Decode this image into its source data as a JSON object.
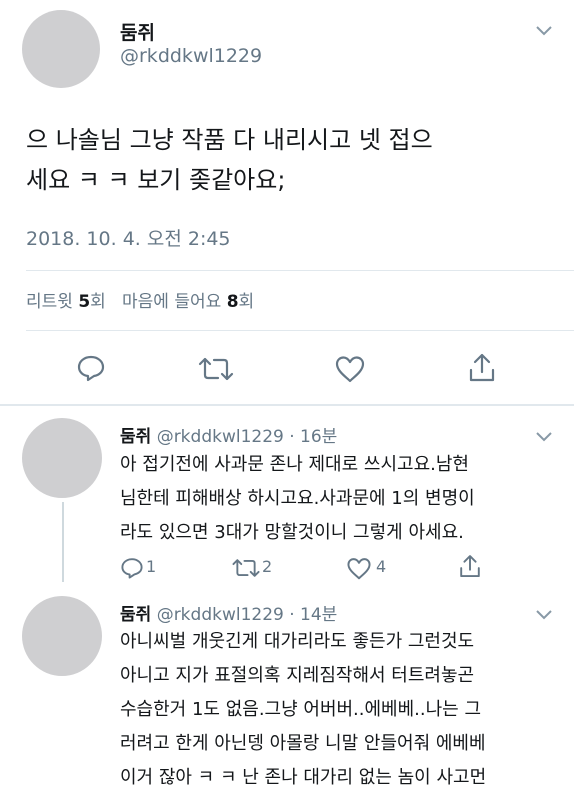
{
  "main_tweet": {
    "display_name": "둠쥐",
    "handle": "@rkddkwl1229",
    "text_line1": "으 나솔님 그냥 작품 다 내리시고 넷 접으",
    "text_line2": "세요 ㅋ ㅋ 보기 좆같아요;",
    "timestamp": "2018. 10. 4. 오전 2:45",
    "retweets_label": "리트윗",
    "retweets_count": "5",
    "retweets_unit": "회",
    "likes_label": "마음에 들어요",
    "likes_count": "8",
    "likes_unit": "회"
  },
  "replies": [
    {
      "display_name": "둠쥐",
      "handle_time": "@rkddkwl1229 · 16분",
      "lines": [
        "아 접기전에 사과문 존나 제대로 쓰시고요.남현",
        "님한테 피해배상 하시고요.사과문에 1의 변명이",
        "라도 있으면 3대가 망할것이니 그렇게 아세요."
      ],
      "reply_count": "1",
      "retweet_count": "2",
      "like_count": "4"
    },
    {
      "display_name": "둠쥐",
      "handle_time": "@rkddkwl1229 · 14분",
      "lines": [
        "아니씨벌 개웃긴게 대가리라도 좋든가 그런것도",
        "아니고 지가 표절의혹 지레짐작해서 터트려놓곤",
        "수습한거 1도 없음.그냥 어버버..에베베..나는 그",
        "러려고 한게 아닌뎅 아몰랑 니말 안들어줘 에베베",
        "이거 잖아 ㅋ ㅋ 난 존나 대가리 없는 놈이 사고먼"
      ]
    }
  ],
  "icons": {
    "reply": "reply-icon",
    "retweet": "retweet-icon",
    "like": "heart-icon",
    "share": "share-icon",
    "more": "chevron-down-icon"
  },
  "colors": {
    "text": "#14171a",
    "secondary": "#657786",
    "divider": "#e1e8ed",
    "avatar": "#cfcfd1"
  }
}
